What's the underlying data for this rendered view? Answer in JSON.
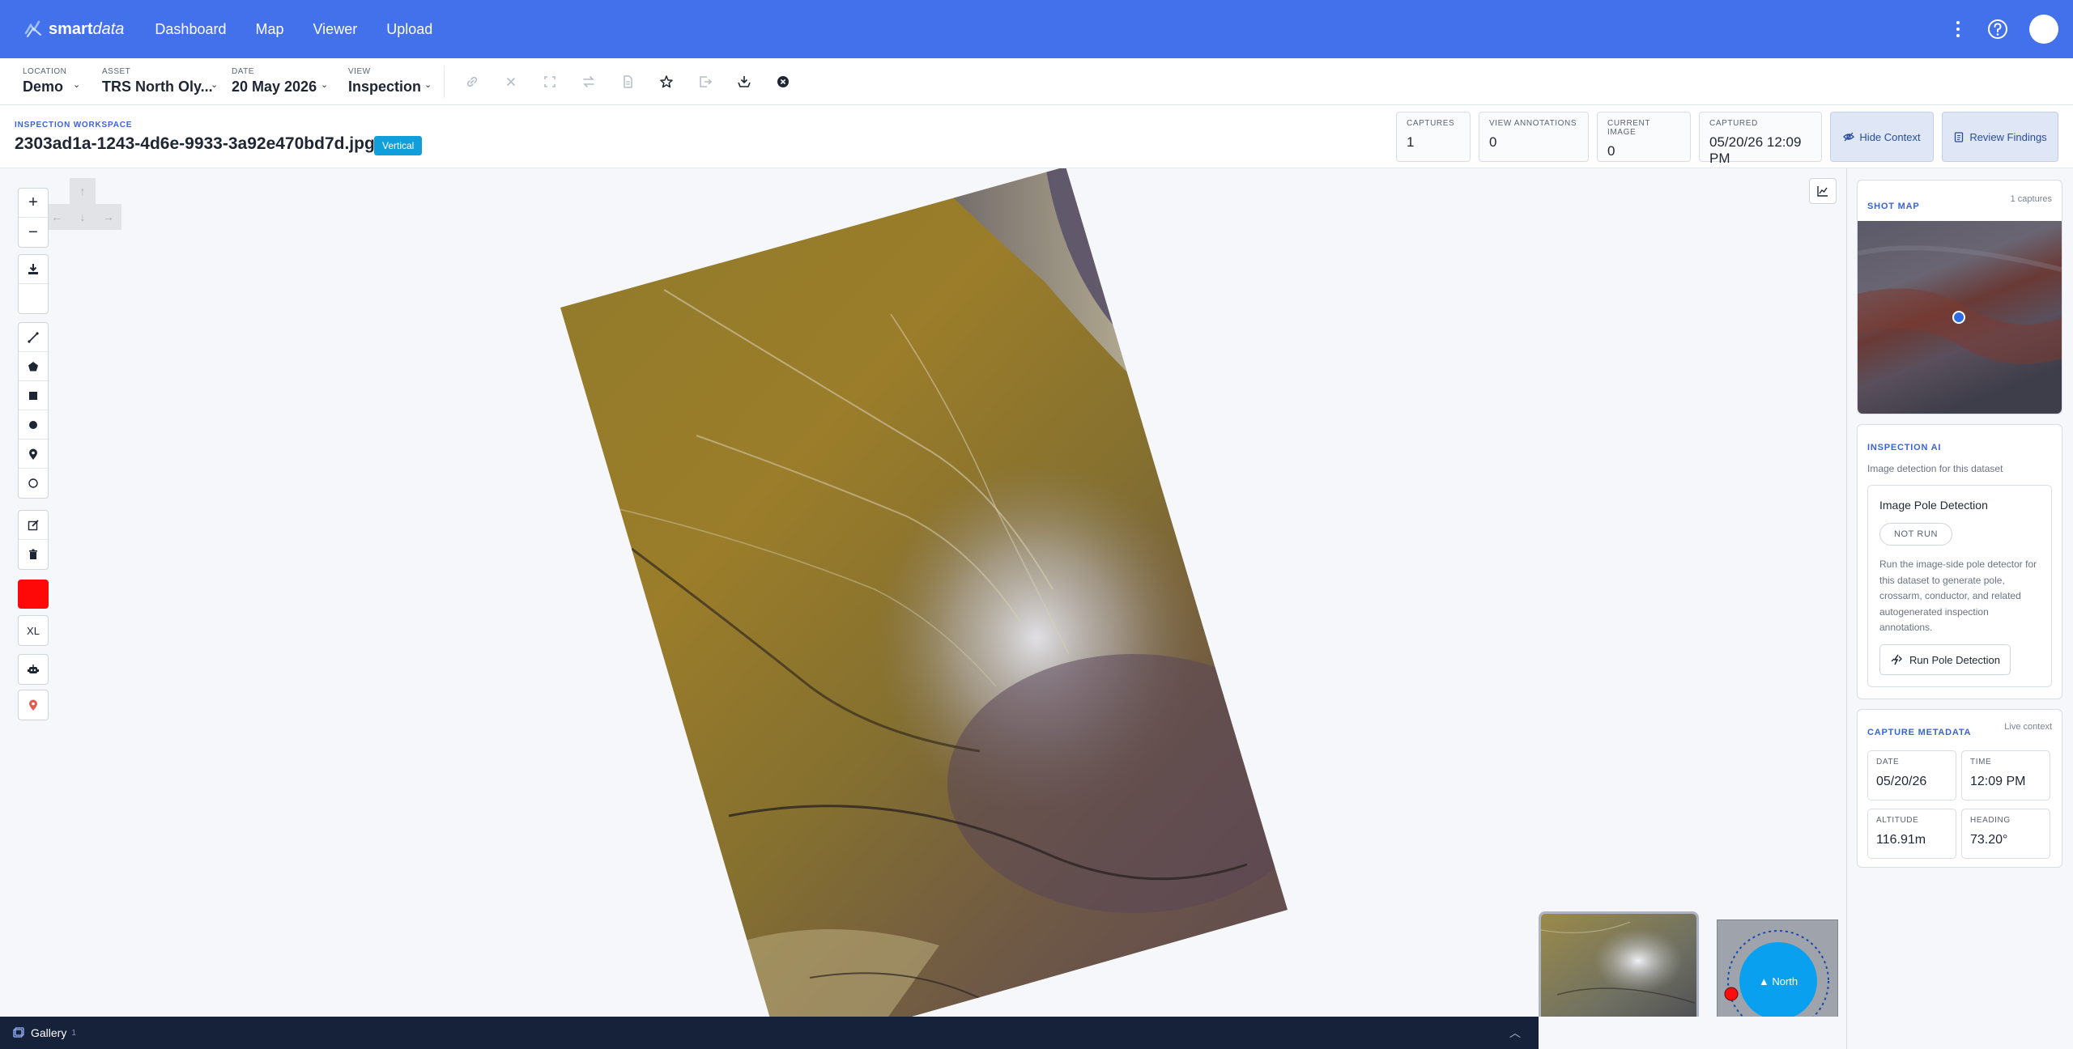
{
  "nav": {
    "logo_bold": "smart",
    "logo_italic": "data",
    "links": [
      "Dashboard",
      "Map",
      "Viewer",
      "Upload"
    ]
  },
  "toolbar": {
    "location_label": "LOCATION",
    "location_value": "Demo",
    "asset_label": "ASSET",
    "asset_value": "TRS North Oly...",
    "date_label": "DATE",
    "date_value": "20 May 2026",
    "view_label": "VIEW",
    "view_value": "Inspection"
  },
  "workspace": {
    "kicker": "INSPECTION WORKSPACE",
    "filename": "2303ad1a-1243-4d6e-9933-3a92e470bd7d.jpg",
    "badge": "Vertical",
    "stats": {
      "captures_label": "CAPTURES",
      "captures_value": "1",
      "view_annotations_label": "VIEW ANNOTATIONS",
      "view_annotations_value": "0",
      "current_image_label": "CURRENT IMAGE",
      "current_image_value": "0",
      "captured_label": "CAPTURED",
      "captured_value": "05/20/26 12:09 PM"
    },
    "hide_context": "Hide Context",
    "review_findings": "Review Findings"
  },
  "viewer": {
    "zoom_in": "+",
    "zoom_out": "−",
    "line_size": "XL",
    "active_color": "#ff0808",
    "compass_label": "▲ North"
  },
  "gallery": {
    "label": "Gallery",
    "count": "1"
  },
  "panel": {
    "shot_map": {
      "title": "SHOT MAP",
      "aside": "1 captures"
    },
    "ai": {
      "title": "INSPECTION AI",
      "subtitle": "Image detection for this dataset",
      "detector_title": "Image Pole Detection",
      "status": "NOT RUN",
      "description": "Run the image-side pole detector for this dataset to generate pole, crossarm, conductor, and related autogenerated inspection annotations.",
      "run_button": "Run Pole Detection"
    },
    "metadata": {
      "title": "CAPTURE METADATA",
      "aside": "Live context",
      "date_label": "DATE",
      "date_value": "05/20/26",
      "time_label": "TIME",
      "time_value": "12:09 PM",
      "altitude_label": "ALTITUDE",
      "altitude_value": "116.91m",
      "heading_label": "HEADING",
      "heading_value": "73.20°"
    }
  }
}
